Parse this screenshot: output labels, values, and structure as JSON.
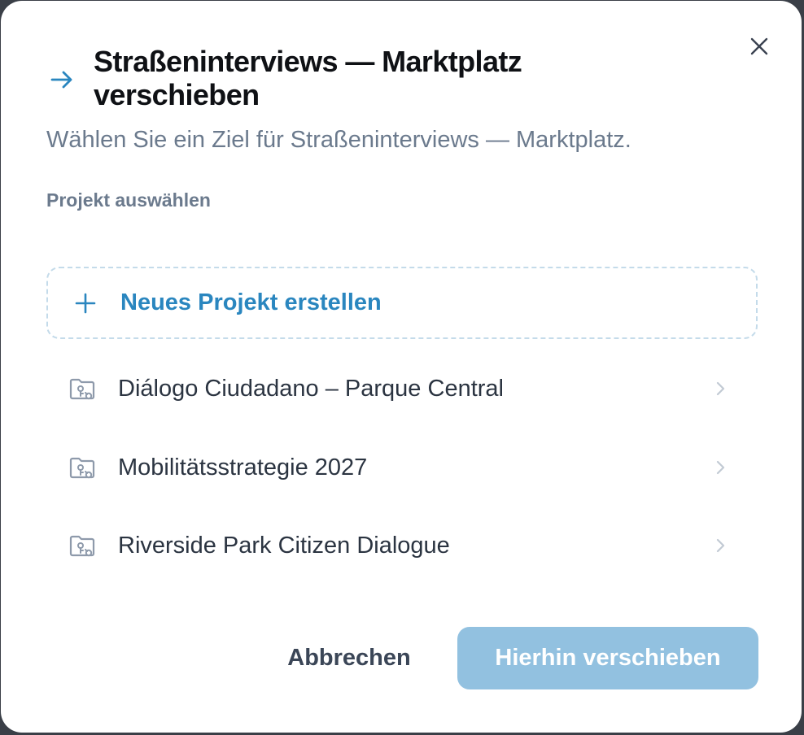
{
  "dialog": {
    "title": "Straßeninterviews — Marktplatz verschieben",
    "subtitle": "Wählen Sie ein Ziel für Straßeninterviews — Marktplatz.",
    "section_label": "Projekt auswählen",
    "title_icon": "arrow-right-icon",
    "close_icon": "close-icon"
  },
  "new_project": {
    "label": "Neues Projekt erstellen",
    "icon": "plus-icon"
  },
  "projects": [
    {
      "name": "Diálogo Ciudadano – Parque Central",
      "icon": "folder-icon"
    },
    {
      "name": "Mobilitätsstrategie 2027",
      "icon": "folder-icon"
    },
    {
      "name": "Riverside Park Citizen Dialogue",
      "icon": "folder-icon"
    }
  ],
  "footer": {
    "cancel_label": "Abbrechen",
    "confirm_label": "Hierhin verschieben",
    "confirm_disabled": true
  },
  "colors": {
    "accent": "#2a86bf",
    "confirm_disabled_bg": "#92c1e0",
    "muted_text": "#6b7a8d",
    "title_text": "#0f1115"
  }
}
